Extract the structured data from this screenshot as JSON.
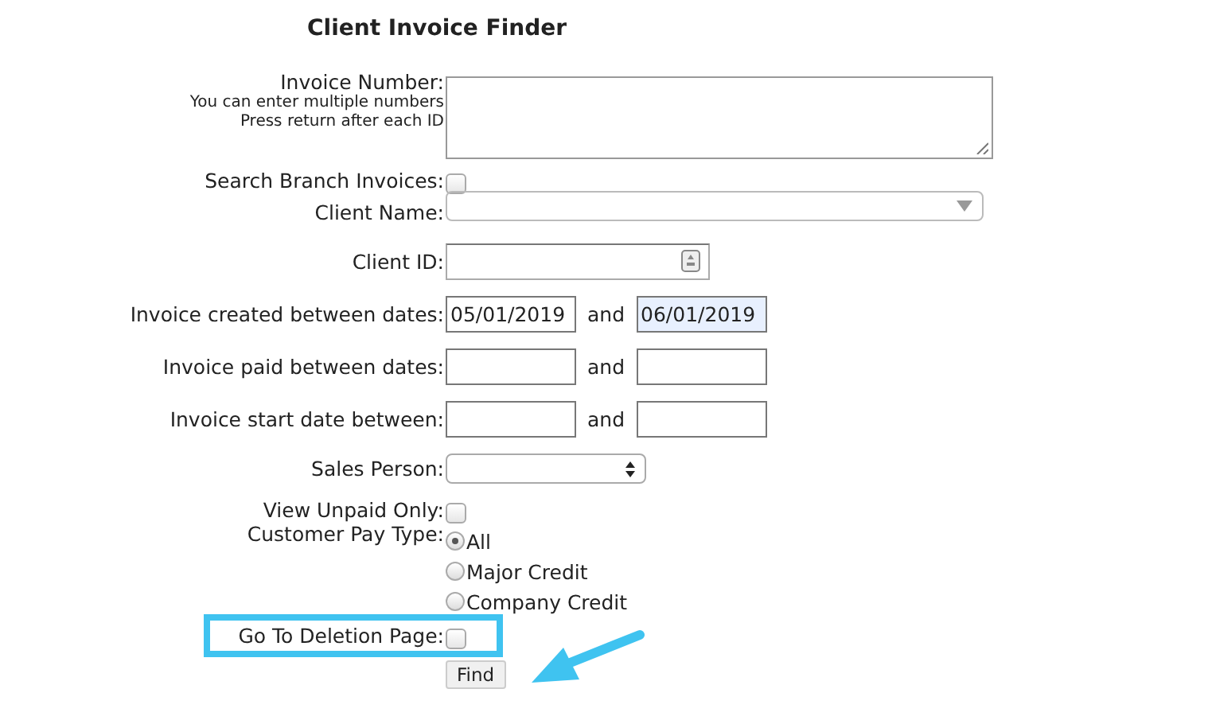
{
  "title": "Client Invoice Finder",
  "rows": [
    {
      "kind": "textarea",
      "label": "Invoice Number:",
      "hints": [
        "You can enter multiple numbers",
        "Press return after each ID"
      ]
    },
    {
      "kind": "checkbox",
      "label": "Search Branch Invoices:",
      "checked": false
    },
    {
      "kind": "combo",
      "label": "Client Name:"
    },
    {
      "kind": "id",
      "label": "Client ID:"
    },
    {
      "kind": "range",
      "label": "Invoice created between dates:",
      "from": "05/01/2019",
      "joiner": "and",
      "to": "06/01/2019"
    },
    {
      "kind": "range",
      "label": "Invoice paid between dates:",
      "joiner": "and"
    },
    {
      "kind": "range",
      "label": "Invoice start date between:",
      "joiner": "and"
    },
    {
      "kind": "select",
      "label": "Sales Person:"
    },
    {
      "kind": "checkbox",
      "label": "View Unpaid Only:",
      "checked": false
    },
    {
      "kind": "radios",
      "label": "Customer Pay Type:",
      "options": [
        {
          "label": "All",
          "selected": true
        },
        {
          "label": "Major Credit",
          "selected": false
        },
        {
          "label": "Company Credit",
          "selected": false
        }
      ]
    },
    {
      "kind": "checkbox",
      "label": "Go To Deletion Page:",
      "checked": false,
      "highlighted": true
    }
  ],
  "button": "Find"
}
